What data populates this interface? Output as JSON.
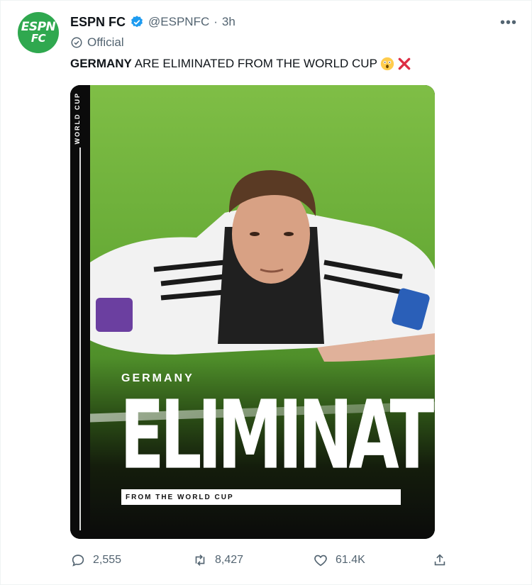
{
  "account": {
    "name": "ESPN FC",
    "handle": "@ESPNFC",
    "separator": "·",
    "time": "3h",
    "official_label": "Official",
    "avatar_line1": "ESPN",
    "avatar_line2": "FC"
  },
  "tweet": {
    "text_bold": "GERMANY",
    "text_rest": " ARE ELIMINATED FROM THE WORLD CUP",
    "emojis": [
      "astonished-face-emoji",
      "cross-mark-emoji"
    ]
  },
  "media": {
    "side_label": "WORLD CUP",
    "headline_small": "GERMANY",
    "headline_big": "ELIMINATED",
    "banner_text": "FROM THE WORLD CUP"
  },
  "actions": {
    "reply_count": "2,555",
    "retweet_count": "8,427",
    "like_count": "61.4K"
  },
  "colors": {
    "brand_green": "#2fa84f",
    "verified_blue": "#1d9bf0",
    "muted_text": "#536471"
  }
}
